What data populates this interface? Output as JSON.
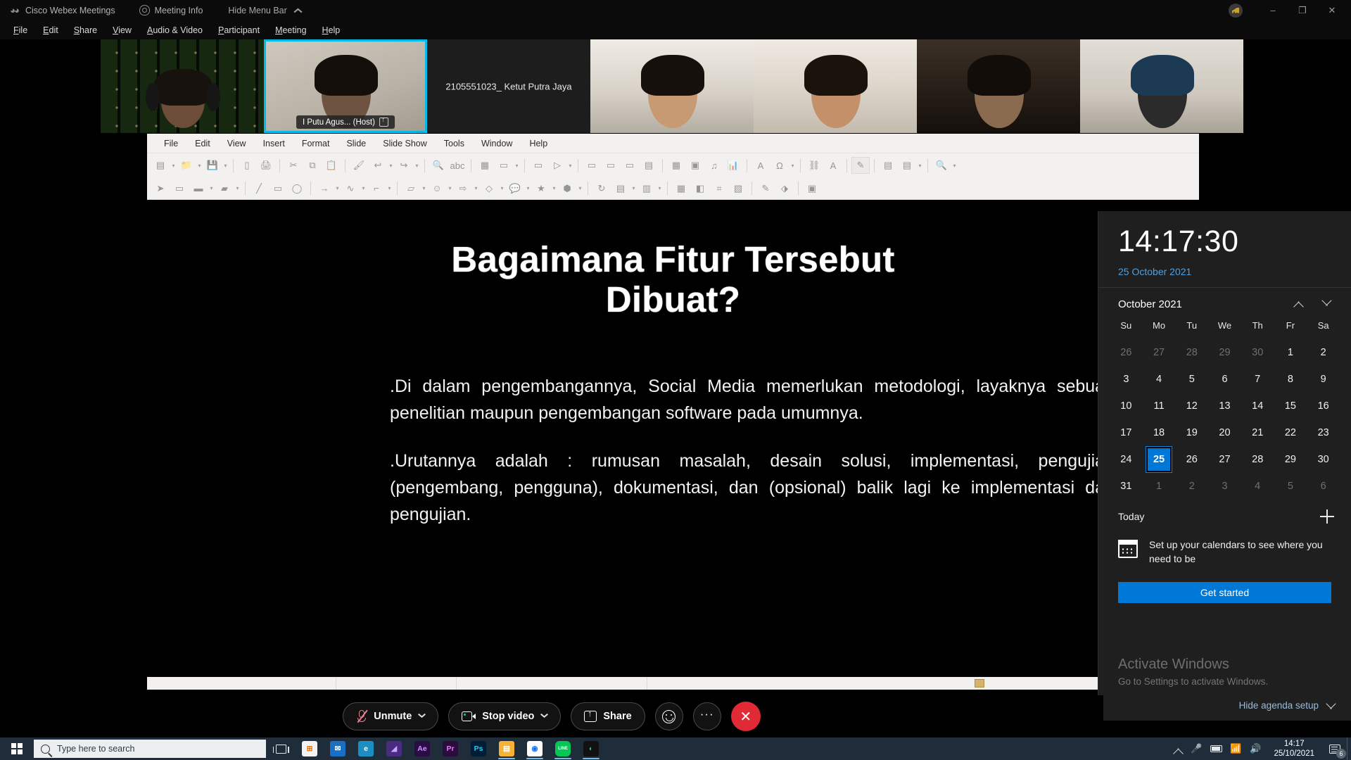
{
  "app": {
    "titlebar": {
      "logo_icon": "webex-logo-icon",
      "title": "Cisco Webex Meetings",
      "meeting_info": "Meeting Info",
      "meeting_info_icon": "shield-icon",
      "hide_menu_bar": "Hide Menu Bar",
      "hide_menu_chevron_icon": "chevron-up-icon",
      "network_icon": "network-quality-icon",
      "minimize": "–",
      "maximize": "❐",
      "close": "✕"
    },
    "menubar": [
      "File",
      "Edit",
      "Share",
      "View",
      "Audio & Video",
      "Participant",
      "Meeting",
      "Help"
    ]
  },
  "thumbnails": [
    {
      "name": "",
      "style": "matrix",
      "active": false,
      "label_pos": "none"
    },
    {
      "name": "I Putu Agus...  (Host)",
      "style": "wall1",
      "active": true,
      "label_pos": "bottom",
      "host_icon": "pin-host-icon"
    },
    {
      "name": "2105551023_ Ketut Putra Jaya",
      "style": "none",
      "active": false,
      "label_pos": "center"
    },
    {
      "name": "",
      "style": "wall2",
      "active": false,
      "label_pos": "none"
    },
    {
      "name": "",
      "style": "wall3",
      "active": false,
      "label_pos": "none"
    },
    {
      "name": "",
      "style": "wall4",
      "active": false,
      "label_pos": "none"
    },
    {
      "name": "",
      "style": "wall5",
      "active": false,
      "label_pos": "none"
    }
  ],
  "impress": {
    "menubar": [
      "File",
      "Edit",
      "View",
      "Insert",
      "Format",
      "Slide",
      "Slide Show",
      "Tools",
      "Window",
      "Help"
    ],
    "toolbar_row1": [
      "new-document-icon",
      "dropdown-caret",
      "open-file-icon",
      "dropdown-caret",
      "save-icon",
      "dropdown-caret",
      "sep",
      "export-pdf-icon",
      "print-icon",
      "sep",
      "cut-icon",
      "copy-icon",
      "paste-icon",
      "sep",
      "clone-formatting-icon",
      "undo-icon",
      "dropdown-caret",
      "redo-icon",
      "dropdown-caret",
      "sep",
      "find-replace-icon",
      "spelling-icon",
      "sep",
      "display-grid-icon",
      "display-views-icon",
      "dropdown-caret",
      "sep",
      "master-slide-icon",
      "start-slideshow-icon",
      "dropdown-caret",
      "sep",
      "new-slide-icon",
      "duplicate-slide-icon",
      "delete-slide-icon",
      "layout-icon",
      "sep",
      "table-icon",
      "image-icon",
      "media-icon",
      "chart-icon",
      "sep",
      "textbox-icon",
      "special-character-icon",
      "dropdown-caret",
      "sep",
      "hyperlink-icon",
      "fontwork-icon",
      "sep",
      "show-draw-functions-icon",
      "sep",
      "header-footer-icon",
      "slide-properties-icon",
      "dropdown-caret",
      "sep",
      "zoom-icon",
      "dropdown-caret"
    ],
    "toolbar_row2": [
      "select-icon",
      "zoom-fit-icon",
      "line-color-icon",
      "dropdown-caret",
      "fill-color-icon",
      "dropdown-caret",
      "sep",
      "insert-line-icon",
      "rectangle-icon",
      "ellipse-icon",
      "sep",
      "arrow-icon",
      "dropdown-caret",
      "curve-icon",
      "dropdown-caret",
      "connector-icon",
      "dropdown-caret",
      "sep",
      "basic-shapes-icon",
      "dropdown-caret",
      "symbol-shapes-icon",
      "dropdown-caret",
      "block-arrows-icon",
      "dropdown-caret",
      "flowchart-icon",
      "dropdown-caret",
      "callout-icon",
      "dropdown-caret",
      "stars-icon",
      "dropdown-caret",
      "3d-objects-icon",
      "dropdown-caret",
      "sep",
      "rotate-icon",
      "align-icon",
      "dropdown-caret",
      "arrange-icon",
      "dropdown-caret",
      "sep",
      "distribute-icon",
      "shadow-icon",
      "crop-icon",
      "filter-icon",
      "sep",
      "points-icon",
      "glue-points-icon",
      "sep",
      "toggle-extrusion-icon"
    ],
    "slide": {
      "title_line1": "Bagaimana Fitur Tersebut",
      "title_line2": "Dibuat?",
      "paragraph1": ".Di dalam pengembangannya, Social Media memerlukan metodologi, layaknya sebuah penelitian maupun pengembangan software pada umumnya.",
      "paragraph2": ".Urutannya adalah : rumusan masalah, desain solusi, implementasi, pengujian (pengembang, pengguna), dokumentasi, dan (opsional) balik lagi ke implementasi dan pengujian."
    }
  },
  "calendar_flyout": {
    "time": "14:17:30",
    "date": "25 October 2021",
    "month_label": "October 2021",
    "prev_icon": "chevron-up-icon",
    "next_icon": "chevron-down-icon",
    "day_headers": [
      "Su",
      "Mo",
      "Tu",
      "We",
      "Th",
      "Fr",
      "Sa"
    ],
    "weeks": [
      [
        {
          "d": "26",
          "m": true
        },
        {
          "d": "27",
          "m": true
        },
        {
          "d": "28",
          "m": true
        },
        {
          "d": "29",
          "m": true
        },
        {
          "d": "30",
          "m": true
        },
        {
          "d": "1",
          "m": false
        },
        {
          "d": "2",
          "m": false
        }
      ],
      [
        {
          "d": "3",
          "m": false
        },
        {
          "d": "4",
          "m": false
        },
        {
          "d": "5",
          "m": false
        },
        {
          "d": "6",
          "m": false
        },
        {
          "d": "7",
          "m": false
        },
        {
          "d": "8",
          "m": false
        },
        {
          "d": "9",
          "m": false
        }
      ],
      [
        {
          "d": "10",
          "m": false
        },
        {
          "d": "11",
          "m": false
        },
        {
          "d": "12",
          "m": false
        },
        {
          "d": "13",
          "m": false
        },
        {
          "d": "14",
          "m": false
        },
        {
          "d": "15",
          "m": false
        },
        {
          "d": "16",
          "m": false
        }
      ],
      [
        {
          "d": "17",
          "m": false
        },
        {
          "d": "18",
          "m": false
        },
        {
          "d": "19",
          "m": false
        },
        {
          "d": "20",
          "m": false
        },
        {
          "d": "21",
          "m": false
        },
        {
          "d": "22",
          "m": false
        },
        {
          "d": "23",
          "m": false
        }
      ],
      [
        {
          "d": "24",
          "m": false
        },
        {
          "d": "25",
          "m": false,
          "today": true
        },
        {
          "d": "26",
          "m": false
        },
        {
          "d": "27",
          "m": false
        },
        {
          "d": "28",
          "m": false
        },
        {
          "d": "29",
          "m": false
        },
        {
          "d": "30",
          "m": false
        }
      ],
      [
        {
          "d": "31",
          "m": false
        },
        {
          "d": "1",
          "m": true
        },
        {
          "d": "2",
          "m": true
        },
        {
          "d": "3",
          "m": true
        },
        {
          "d": "4",
          "m": true
        },
        {
          "d": "5",
          "m": true
        },
        {
          "d": "6",
          "m": true
        }
      ]
    ],
    "today_label": "Today",
    "add_event_icon": "plus-icon",
    "agenda_icon": "calendar-icon",
    "agenda_text": "Set up your calendars to see where you need to be",
    "get_started": "Get started",
    "activate_title": "Activate Windows",
    "activate_subtitle": "Go to Settings to activate Windows.",
    "hide_agenda": "Hide agenda setup",
    "hide_agenda_icon": "chevron-down-icon",
    "accent_color": "#0078d7",
    "date_link_color": "#4ea0e0"
  },
  "control_bar": {
    "mute": {
      "label": "Unmute",
      "icon": "mic-muted-icon",
      "caret_icon": "chevron-down-icon"
    },
    "video": {
      "label": "Stop video",
      "icon": "camera-icon",
      "caret_icon": "chevron-down-icon"
    },
    "share": {
      "label": "Share",
      "icon": "share-screen-icon"
    },
    "reactions": {
      "icon": "reactions-smiley-icon"
    },
    "more": {
      "icon": "more-options-icon",
      "label": "···"
    },
    "end": {
      "icon": "end-call-icon",
      "label": "✕",
      "color": "#e02b36"
    }
  },
  "taskbar": {
    "start_icon": "windows-start-icon",
    "search_placeholder": "Type here to search",
    "search_icon": "search-icon",
    "task_view_icon": "task-view-icon",
    "apps": [
      {
        "name": "microsoft-store-icon",
        "glyph": "⊞",
        "bg": "#f3f3f3",
        "fg": "#e8710a",
        "open": false
      },
      {
        "name": "mail-icon",
        "glyph": "✉",
        "bg": "#1a6fc4",
        "fg": "#ffffff",
        "open": false
      },
      {
        "name": "microsoft-edge-icon",
        "glyph": "e",
        "bg": "#1b8ec2",
        "fg": "#ffffff",
        "open": false
      },
      {
        "name": "wondershare-icon",
        "glyph": "◢",
        "bg": "#4b2a82",
        "fg": "#c9a6ff",
        "open": false
      },
      {
        "name": "after-effects-icon",
        "glyph": "Ae",
        "bg": "#2a0d45",
        "fg": "#cf96fd",
        "open": false
      },
      {
        "name": "premiere-pro-icon",
        "glyph": "Pr",
        "bg": "#2a0d3d",
        "fg": "#ea77ff",
        "open": false
      },
      {
        "name": "photoshop-icon",
        "glyph": "Ps",
        "bg": "#001e36",
        "fg": "#31c5f0",
        "open": false
      },
      {
        "name": "file-explorer-icon",
        "glyph": "▤",
        "bg": "#f5b233",
        "fg": "#ffffff",
        "open": true
      },
      {
        "name": "google-chrome-icon",
        "glyph": "◉",
        "bg": "#ffffff",
        "fg": "#1a73e8",
        "open": true
      },
      {
        "name": "line-icon",
        "glyph": "LINE",
        "bg": "#06c755",
        "fg": "#ffffff",
        "open": true
      },
      {
        "name": "webex-icon",
        "glyph": "◐",
        "bg": "#111111",
        "fg": "#21c36b",
        "open": true
      }
    ],
    "tray": {
      "show_hidden_icon": "chevron-up-icon",
      "mic_icon": "microphone-icon",
      "battery_icon": "battery-icon",
      "wifi_icon": "wifi-icon",
      "volume_icon": "speaker-icon",
      "time": "14:17",
      "date": "25/10/2021",
      "action_center_icon": "action-center-icon",
      "notification_count": "6",
      "show_desktop_icon": "show-desktop-icon"
    }
  }
}
